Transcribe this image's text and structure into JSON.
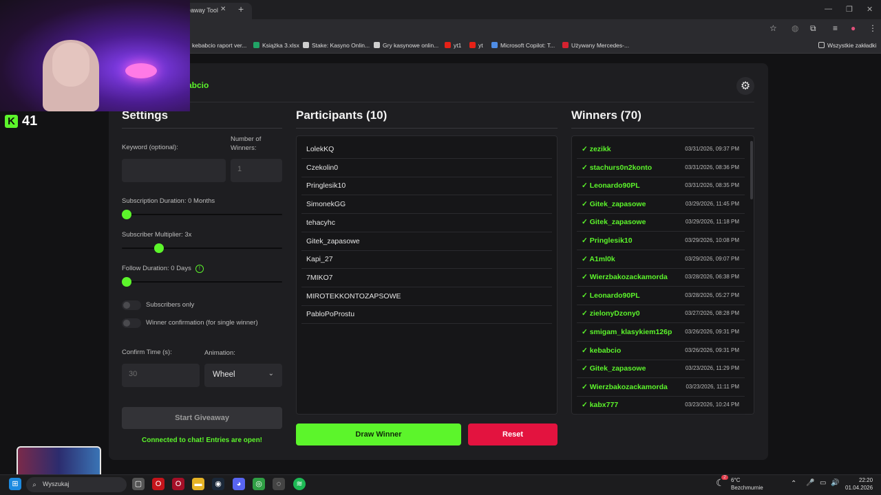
{
  "browser": {
    "tab_title": "eaway Tool",
    "bookmarks": [
      {
        "label": "kebabcio raport ver...",
        "color": "#3c8e3c"
      },
      {
        "label": "Książka 3.xlsx",
        "color": "#21a366"
      },
      {
        "label": "Stake: Kasyno Onlin...",
        "color": "#cfcfcf"
      },
      {
        "label": "Gry kasynowe onlin...",
        "color": "#cfcfcf"
      },
      {
        "label": "yt1",
        "color": "#e62117"
      },
      {
        "label": "yt",
        "color": "#e62117"
      },
      {
        "label": "Microsoft Copilot: T...",
        "color": "#4f8de6"
      },
      {
        "label": "Używany Mercedes-...",
        "color": "#d62230"
      }
    ],
    "all_bookmarks": "Wszystkie zakładki"
  },
  "app": {
    "brand": "abcio",
    "accent": "#5cf52b",
    "danger": "#e3133f"
  },
  "overlay": {
    "viewer_count": "41"
  },
  "settings": {
    "title": "Settings",
    "keyword_label": "Keyword (optional):",
    "keyword_value": "",
    "winners_label": "Number of Winners:",
    "winners_placeholder": "1",
    "sub_duration_label": "Subscription Duration: 0 Months",
    "sub_duration_value": 0,
    "sub_multiplier_label": "Subscriber Multiplier: 3x",
    "sub_multiplier_value": 3,
    "follow_duration_label": "Follow Duration:  0  Days",
    "follow_duration_value": 0,
    "subscribers_only_label": "Subscribers only",
    "subscribers_only": false,
    "winner_confirm_label": "Winner confirmation (for single winner)",
    "winner_confirm": false,
    "confirm_time_label": "Confirm Time (s):",
    "confirm_time_placeholder": "30",
    "animation_label": "Animation:",
    "animation_value": "Wheel",
    "start_button": "Start Giveaway",
    "status": "Connected to chat! Entries are open!"
  },
  "participants": {
    "title": "Participants (10)",
    "items": [
      "LolekKQ",
      "Czekolin0",
      "Pringlesik10",
      "SimonekGG",
      "tehacyhc",
      "Gitek_zapasowe",
      "Kapi_27",
      "7MIKO7",
      "MIROTEKKONTOZAPSOWE",
      "PabloPoProstu"
    ]
  },
  "winners": {
    "title": "Winners (70)",
    "items": [
      {
        "name": "✓ zezikk",
        "date": "03/31/2026, 09:37 PM"
      },
      {
        "name": "✓ stachurs0n2konto",
        "date": "03/31/2026, 08:36 PM"
      },
      {
        "name": "✓ Leonardo90PL",
        "date": "03/31/2026, 08:35 PM"
      },
      {
        "name": "✓ Gitek_zapasowe",
        "date": "03/29/2026, 11:45 PM"
      },
      {
        "name": "✓ Gitek_zapasowe",
        "date": "03/29/2026, 11:18 PM"
      },
      {
        "name": "✓ Pringlesik10",
        "date": "03/29/2026, 10:08 PM"
      },
      {
        "name": "✓ A1ml0k",
        "date": "03/29/2026, 09:07 PM"
      },
      {
        "name": "✓ Wierzbakozackamorda",
        "date": "03/28/2026, 06:38 PM"
      },
      {
        "name": "✓ Leonardo90PL",
        "date": "03/28/2026, 05:27 PM"
      },
      {
        "name": "✓ zielonyDzony0",
        "date": "03/27/2026, 08:28 PM"
      },
      {
        "name": "✓ smigam_klasykiem126p",
        "date": "03/26/2026, 09:31 PM"
      },
      {
        "name": "✓ kebabcio",
        "date": "03/26/2026, 09:31 PM"
      },
      {
        "name": "✓ Gitek_zapasowe",
        "date": "03/23/2026, 11:29 PM"
      },
      {
        "name": "✓ Wierzbakozackamorda",
        "date": "03/23/2026, 11:11 PM"
      },
      {
        "name": "✓ kabx777",
        "date": "03/23/2026, 10:24 PM"
      }
    ]
  },
  "actions": {
    "draw": "Draw Winner",
    "reset": "Reset"
  },
  "taskbar": {
    "search": "Wyszukaj",
    "weather_temp": "6°C",
    "weather_desc": "Bezchmurnie",
    "time": "22:20",
    "date": "01.04.2026",
    "notification_count": "2"
  }
}
